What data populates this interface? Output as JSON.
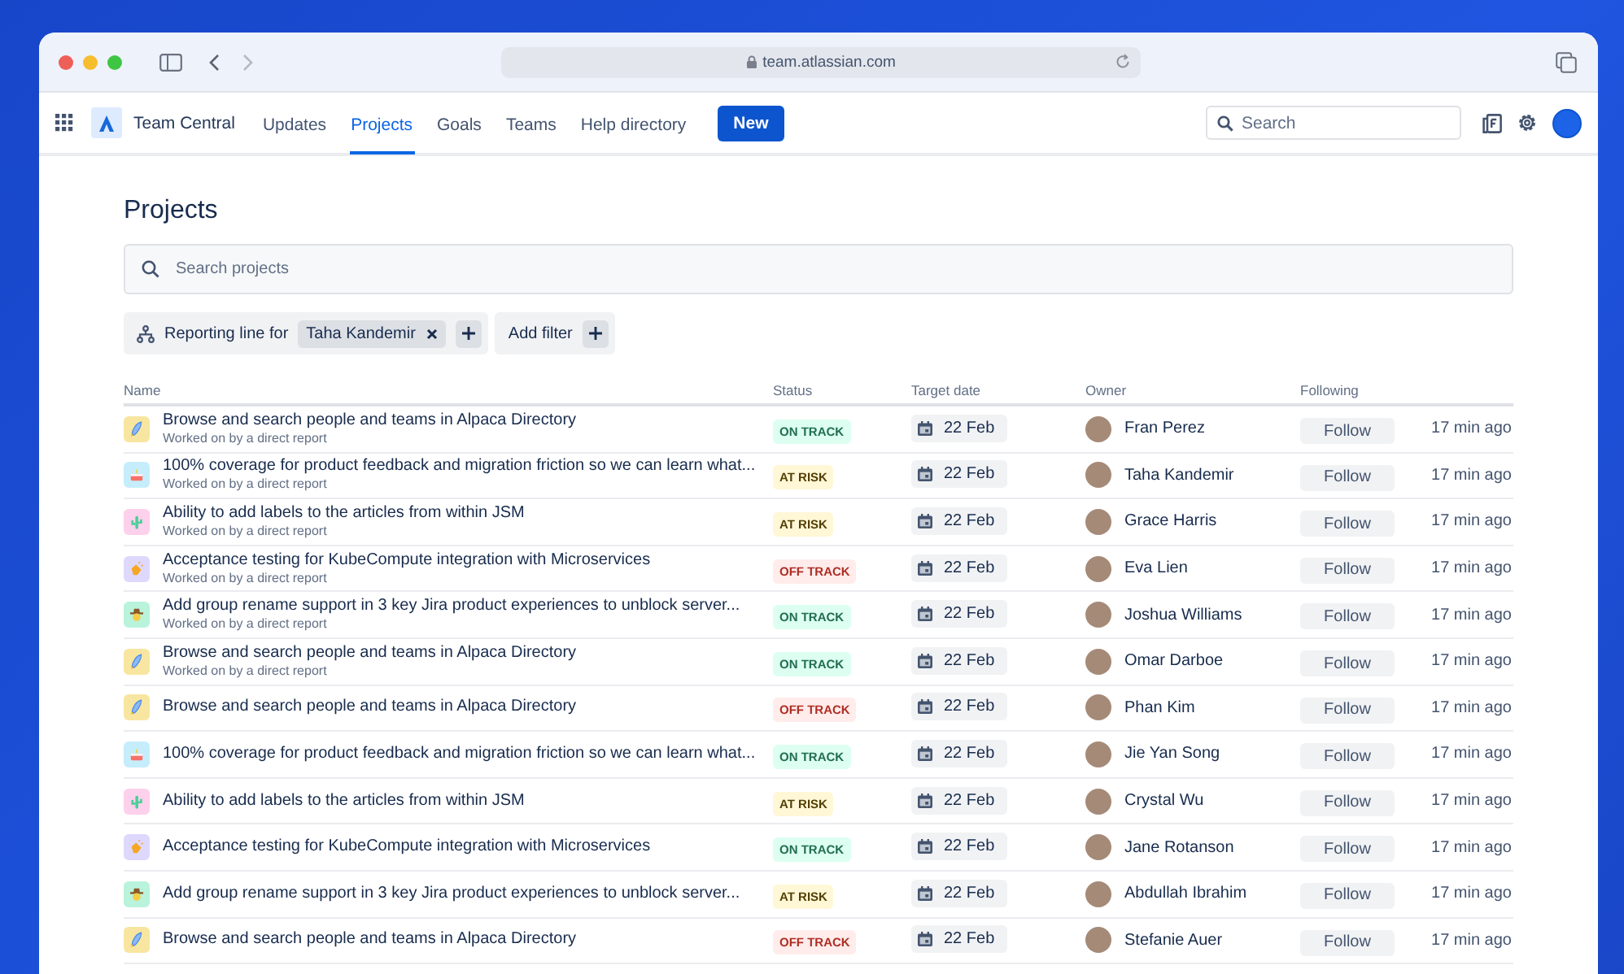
{
  "browser": {
    "url": "team.atlassian.com"
  },
  "nav": {
    "product": "Team Central",
    "tabs": [
      {
        "label": "Updates",
        "selected": false
      },
      {
        "label": "Projects",
        "selected": true
      },
      {
        "label": "Goals",
        "selected": false
      },
      {
        "label": "Teams",
        "selected": false
      },
      {
        "label": "Help directory",
        "selected": false
      }
    ],
    "new_button": "New",
    "search": {
      "placeholder": "Search"
    }
  },
  "page": {
    "title": "Projects",
    "search": {
      "placeholder": "Search projects"
    },
    "filter": {
      "label": "Reporting line for",
      "value": "Taha Kandemir"
    },
    "add_filter": "Add filter"
  },
  "table": {
    "columns": [
      "Name",
      "Status",
      "Target date",
      "Owner",
      "Following"
    ],
    "rows": [
      {
        "icon": {
          "kind": "rocket"
        },
        "name": "Browse and search people and teams in Alpaca Directory",
        "subtitle": "Worked on by a direct report",
        "status": {
          "kind": "on_track",
          "label": "ON TRACK"
        },
        "target_date": "22 Feb",
        "owner": "Fran Perez",
        "follow": "Follow",
        "updated": "17 min ago"
      },
      {
        "icon": {
          "kind": "cake"
        },
        "name": "100% coverage for product feedback and migration friction so we can learn what...",
        "subtitle": "Worked on by a direct report",
        "status": {
          "kind": "at_risk",
          "label": "AT RISK"
        },
        "target_date": "22 Feb",
        "owner": "Taha Kandemir",
        "follow": "Follow",
        "updated": "17 min ago"
      },
      {
        "icon": {
          "kind": "cactus"
        },
        "name": "Ability to add labels to the articles from within JSM",
        "subtitle": "Worked on by a direct report",
        "status": {
          "kind": "at_risk",
          "label": "AT RISK"
        },
        "target_date": "22 Feb",
        "owner": "Grace Harris",
        "follow": "Follow",
        "updated": "17 min ago"
      },
      {
        "icon": {
          "kind": "clap"
        },
        "name": "Acceptance testing for KubeCompute integration with Microservices",
        "subtitle": "Worked on by a direct report",
        "status": {
          "kind": "off_track",
          "label": "OFF TRACK"
        },
        "target_date": "22 Feb",
        "owner": "Eva Lien",
        "follow": "Follow",
        "updated": "17 min ago"
      },
      {
        "icon": {
          "kind": "cowboy"
        },
        "name": "Add group rename support in 3 key Jira product experiences to unblock server...",
        "subtitle": "Worked on by a direct report",
        "status": {
          "kind": "on_track",
          "label": "ON TRACK"
        },
        "target_date": "22 Feb",
        "owner": "Joshua Williams",
        "follow": "Follow",
        "updated": "17 min ago"
      },
      {
        "icon": {
          "kind": "rocket"
        },
        "name": "Browse and search people and teams in Alpaca Directory",
        "subtitle": "Worked on by a direct report",
        "status": {
          "kind": "on_track",
          "label": "ON TRACK"
        },
        "target_date": "22 Feb",
        "owner": "Omar Darboe",
        "follow": "Follow",
        "updated": "17 min ago"
      },
      {
        "icon": {
          "kind": "rocket"
        },
        "name": "Browse and search people and teams in Alpaca Directory",
        "status": {
          "kind": "off_track",
          "label": "OFF TRACK"
        },
        "target_date": "22 Feb",
        "owner": "Phan Kim",
        "follow": "Follow",
        "updated": "17 min ago"
      },
      {
        "icon": {
          "kind": "cake"
        },
        "name": "100% coverage for product feedback and migration friction so we can learn what...",
        "status": {
          "kind": "on_track",
          "label": "ON TRACK"
        },
        "target_date": "22 Feb",
        "owner": "Jie Yan Song",
        "follow": "Follow",
        "updated": "17 min ago"
      },
      {
        "icon": {
          "kind": "cactus"
        },
        "name": "Ability to add labels to the articles from within JSM",
        "status": {
          "kind": "at_risk",
          "label": "AT RISK"
        },
        "target_date": "22 Feb",
        "owner": "Crystal Wu",
        "follow": "Follow",
        "updated": "17 min ago"
      },
      {
        "icon": {
          "kind": "clap"
        },
        "name": "Acceptance testing for KubeCompute integration with Microservices",
        "status": {
          "kind": "on_track",
          "label": "ON TRACK"
        },
        "target_date": "22 Feb",
        "owner": "Jane Rotanson",
        "follow": "Follow",
        "updated": "17 min ago"
      },
      {
        "icon": {
          "kind": "cowboy"
        },
        "name": "Add group rename support in 3 key Jira product experiences to unblock server...",
        "status": {
          "kind": "at_risk",
          "label": "AT RISK"
        },
        "target_date": "22 Feb",
        "owner": "Abdullah Ibrahim",
        "follow": "Follow",
        "updated": "17 min ago"
      },
      {
        "icon": {
          "kind": "rocket"
        },
        "name": "Browse and search people and teams in Alpaca Directory",
        "status": {
          "kind": "off_track",
          "label": "OFF TRACK"
        },
        "target_date": "22 Feb",
        "owner": "Stefanie Auer",
        "follow": "Follow",
        "updated": "17 min ago"
      }
    ]
  }
}
